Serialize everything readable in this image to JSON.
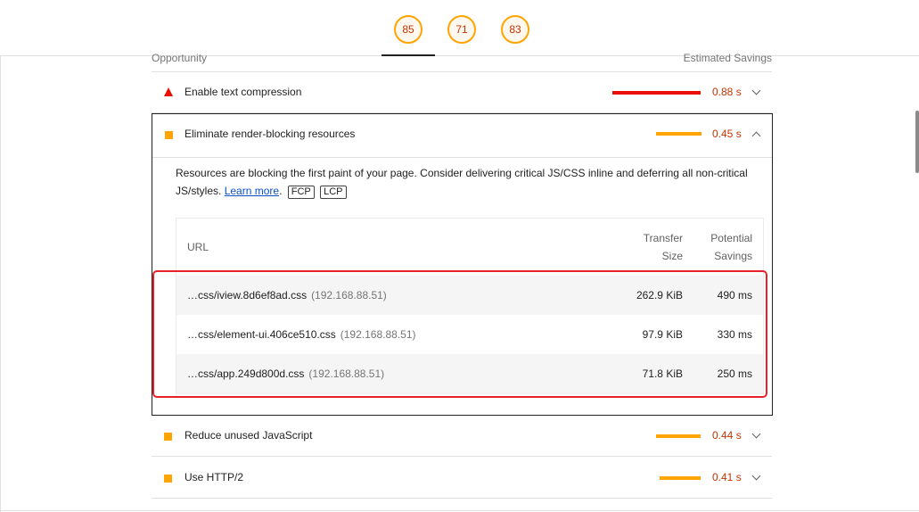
{
  "scores": [
    "85",
    "71",
    "83"
  ],
  "header": {
    "left": "Opportunity",
    "right": "Estimated Savings"
  },
  "audits": [
    {
      "title": "Enable text compression",
      "savings": "0.88 s",
      "severity": "fail",
      "color": "#eb0f00",
      "value_color": "#c33300"
    },
    {
      "title": "Eliminate render-blocking resources",
      "savings": "0.45 s",
      "severity": "average",
      "color": "#ffa400",
      "value_color": "#c33300"
    },
    {
      "title": "Reduce unused JavaScript",
      "savings": "0.44 s",
      "severity": "average",
      "color": "#ffa400",
      "value_color": "#c33300"
    },
    {
      "title": "Use HTTP/2",
      "savings": "0.41 s",
      "severity": "average",
      "color": "#ffa400",
      "value_color": "#c33300"
    }
  ],
  "detail": {
    "description": "Resources are blocking the first paint of your page. Consider delivering critical JS/CSS inline and deferring all non-critical JS/styles.",
    "learn_more": "Learn more",
    "badges": [
      "FCP",
      "LCP"
    ],
    "columns": {
      "url": "URL",
      "transfer_1": "Transfer",
      "transfer_2": "Size",
      "savings_1": "Potential",
      "savings_2": "Savings"
    },
    "rows": [
      {
        "url": "…css/iview.8d6ef8ad.css",
        "host": "(192.168.88.51)",
        "size": "262.9 KiB",
        "savings": "490 ms"
      },
      {
        "url": "…css/element-ui.406ce510.css",
        "host": "(192.168.88.51)",
        "size": "97.9 KiB",
        "savings": "330 ms"
      },
      {
        "url": "…css/app.249d800d.css",
        "host": "(192.168.88.51)",
        "size": "71.8 KiB",
        "savings": "250 ms"
      }
    ]
  }
}
